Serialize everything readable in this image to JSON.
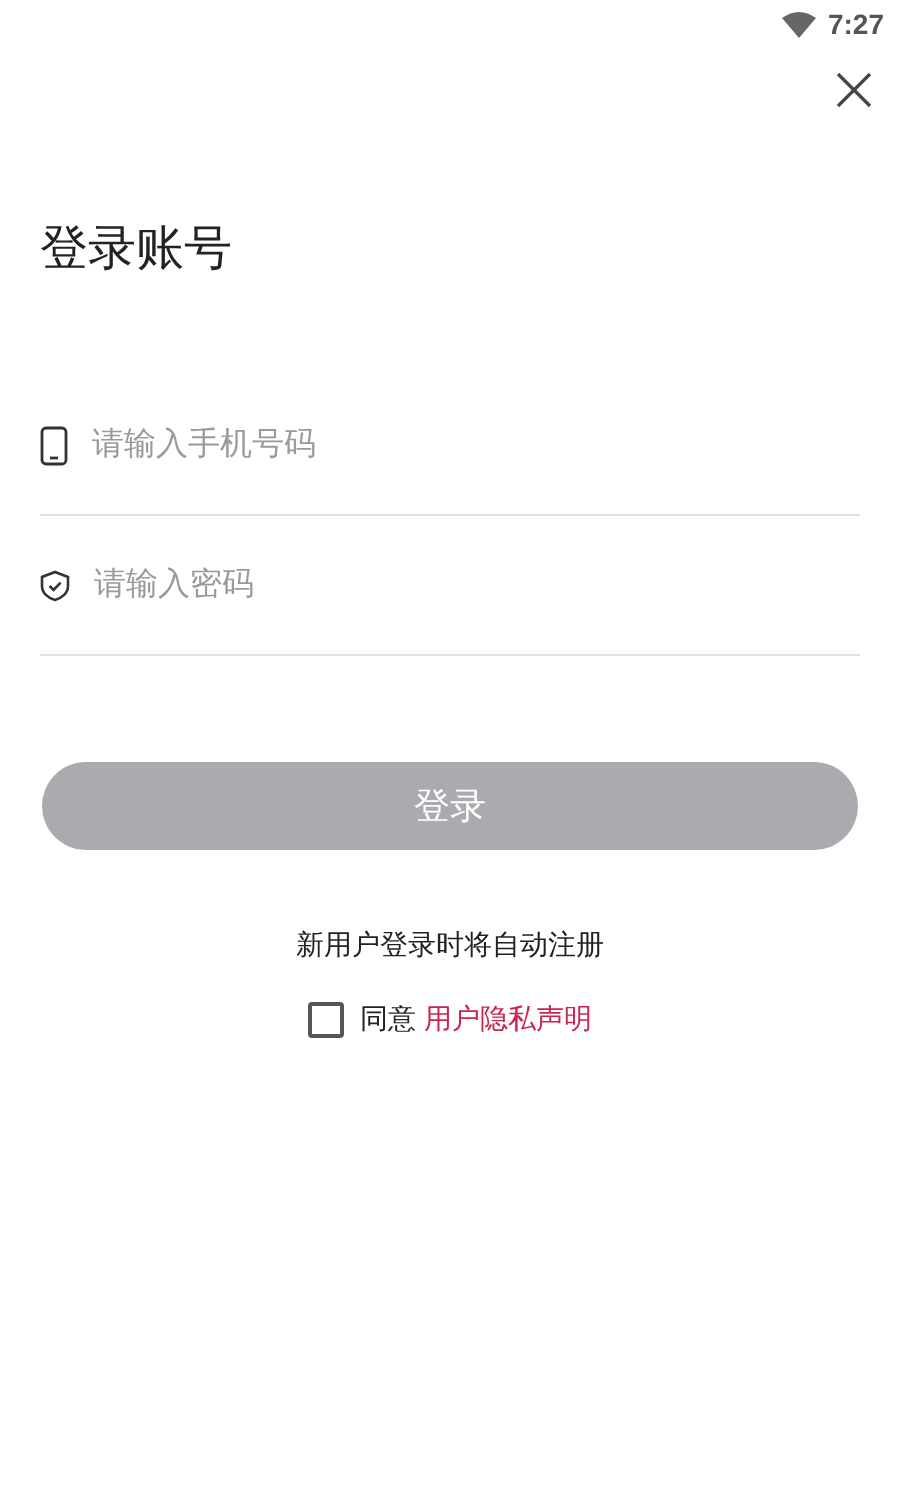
{
  "status_bar": {
    "time": "7:27"
  },
  "title": "登录账号",
  "fields": [
    {
      "kind": "phone",
      "placeholder": "请输入手机号码"
    },
    {
      "kind": "password",
      "placeholder": "请输入密码"
    }
  ],
  "login_button": {
    "label": "登录",
    "disabled": true
  },
  "note": "新用户登录时将自动注册",
  "agreement": {
    "checked": false,
    "text": "同意",
    "link": "用户隐私声明"
  }
}
